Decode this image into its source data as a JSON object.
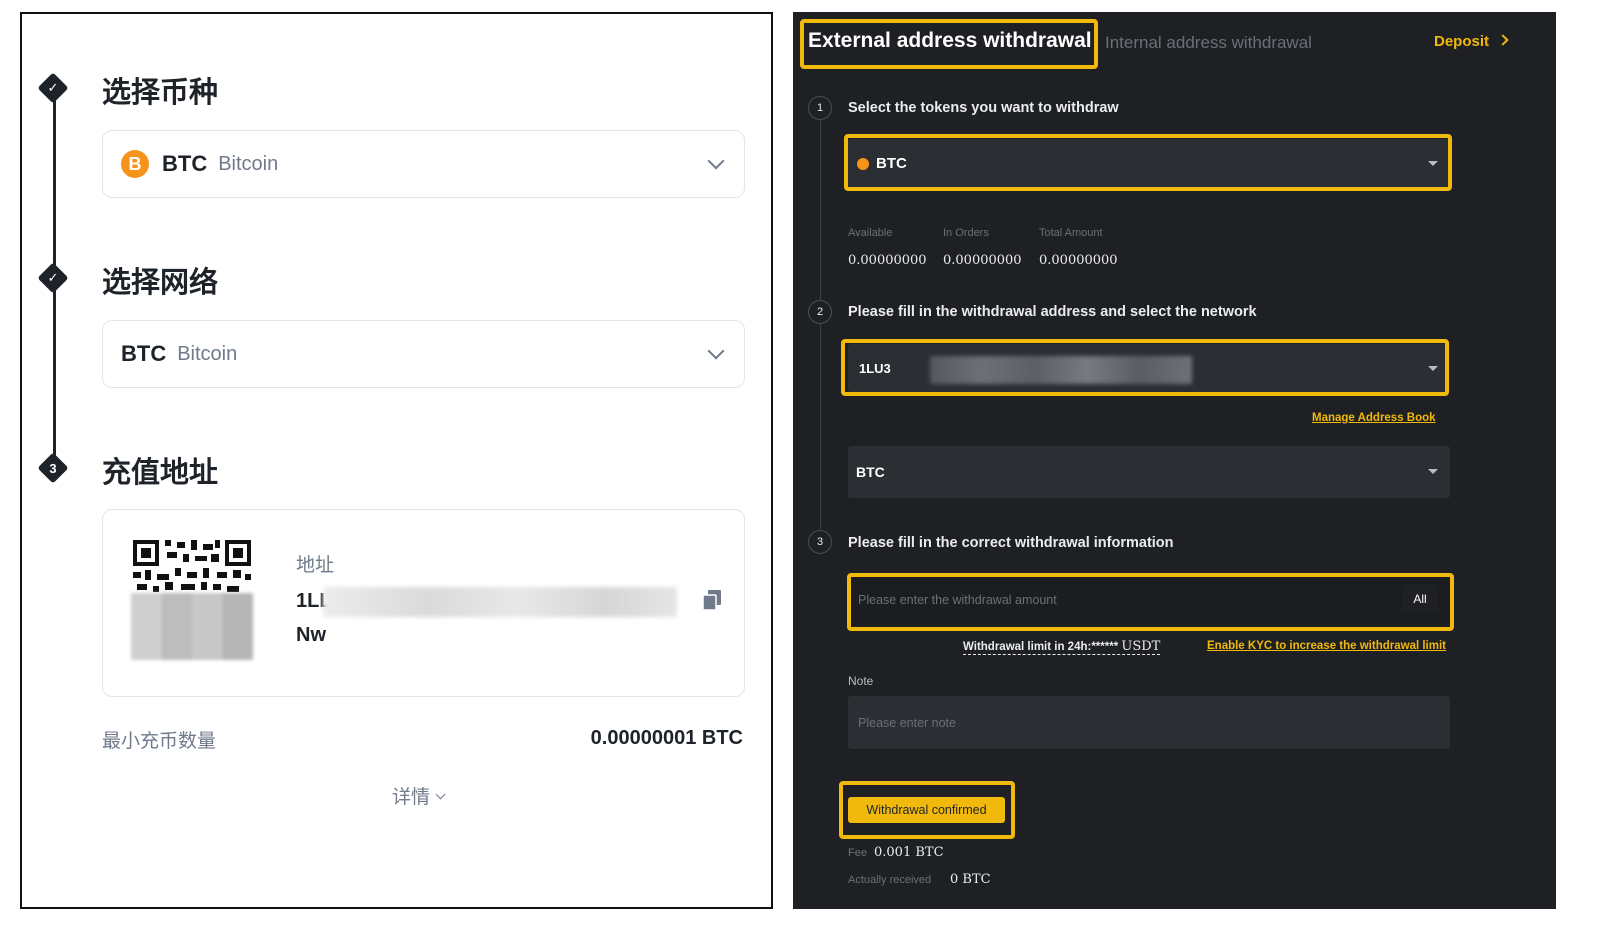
{
  "left": {
    "step1": {
      "title": "选择币种",
      "symbol": "BTC",
      "name": "Bitcoin",
      "coin_icon": "B"
    },
    "step2": {
      "title": "选择网络",
      "symbol": "BTC",
      "name": "Bitcoin"
    },
    "step3": {
      "title": "充值地址",
      "number": "3",
      "address_label": "地址",
      "address_line1": "1LL",
      "address_line2": "Nw"
    },
    "min_deposit_label": "最小充币数量",
    "min_deposit_value": "0.00000001 BTC",
    "details_label": "详情"
  },
  "right": {
    "tabs": {
      "external": "External address withdrawal",
      "internal": "Internal address withdrawal"
    },
    "deposit_label": "Deposit",
    "step1": {
      "number": "1",
      "label": "Select the tokens you want to withdraw",
      "token": "BTC"
    },
    "balances": {
      "available_label": "Available",
      "available_value": "0.00000000",
      "in_orders_label": "In Orders",
      "in_orders_value": "0.00000000",
      "total_label": "Total Amount",
      "total_value": "0.00000000"
    },
    "step2": {
      "number": "2",
      "label": "Please fill in the withdrawal address and select the network",
      "address_prefix": "1LU3",
      "manage_link": "Manage Address Book",
      "network": "BTC"
    },
    "step3": {
      "number": "3",
      "label": "Please fill in the correct withdrawal information",
      "amount_placeholder": "Please enter the withdrawal amount",
      "all_button": "All",
      "limit_text": "Withdrawal limit in 24h:****** ",
      "limit_unit": "USDT",
      "kyc_link": "Enable KYC to increase the withdrawal limit"
    },
    "note": {
      "label": "Note",
      "placeholder": "Please enter note"
    },
    "confirm_button": "Withdrawal confirmed",
    "fee_label": "Fee",
    "fee_value": "0.001 BTC",
    "received_label": "Actually received",
    "received_value": "0 BTC"
  },
  "colors": {
    "accent": "#f0b90b",
    "bitcoin": "#f7931a",
    "dark_bg": "#1f2024",
    "field_bg": "#2b2e33"
  }
}
